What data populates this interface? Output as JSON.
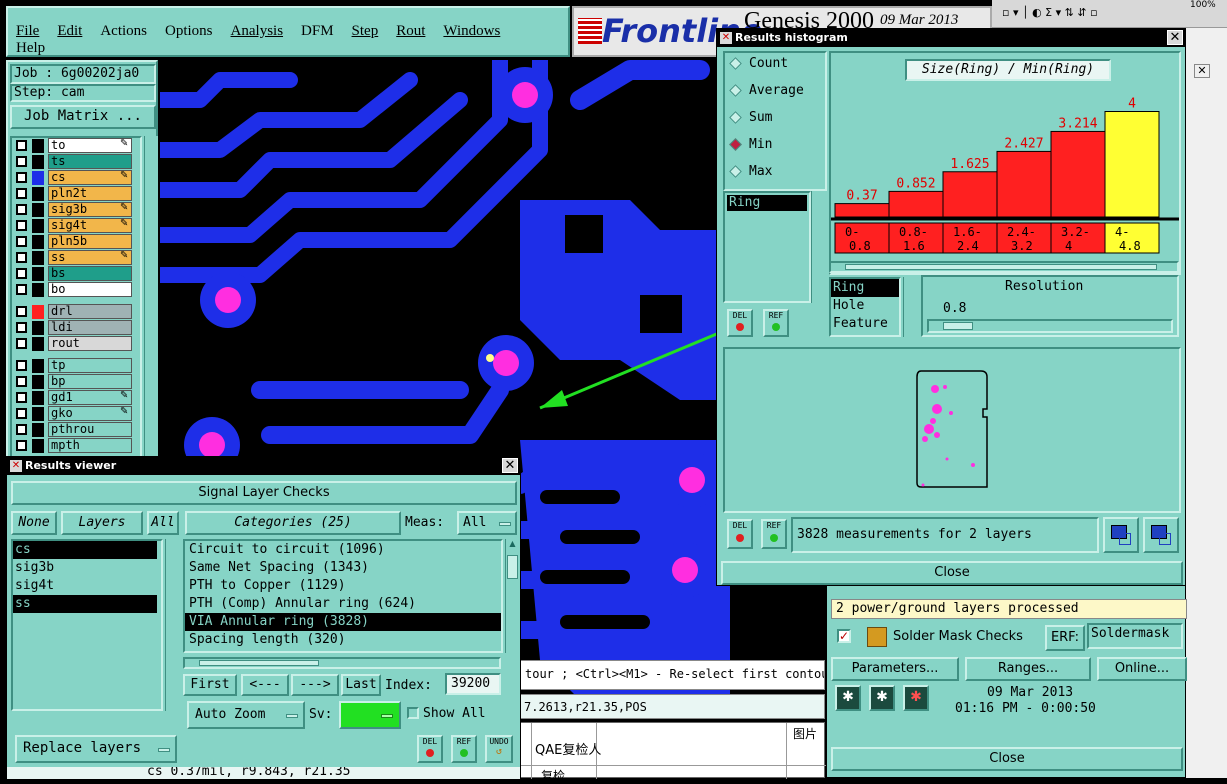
{
  "menu": [
    "File",
    "Edit",
    "Actions",
    "Options",
    "Analysis",
    "DFM",
    "Step",
    "Rout",
    "Windows",
    "Help"
  ],
  "brand": {
    "logo": "Frontline",
    "product": "Genesis 2000",
    "date": "09 Mar 2013"
  },
  "job": {
    "job_line": "Job : 6g00202ja0",
    "step_line": "Step: cam",
    "matrix_button": "Job Matrix ..."
  },
  "layers": [
    {
      "name": "to",
      "color": "#ffffff",
      "edit": true
    },
    {
      "name": "ts",
      "color": "#1f9e8a",
      "edit": false
    },
    {
      "name": "cs",
      "color": "#f2b64a",
      "edit": true
    },
    {
      "name": "pln2t",
      "color": "#f2b64a",
      "edit": false
    },
    {
      "name": "sig3b",
      "color": "#f2b64a",
      "edit": true
    },
    {
      "name": "sig4t",
      "color": "#f2b64a",
      "edit": true
    },
    {
      "name": "pln5b",
      "color": "#f2b64a",
      "edit": false
    },
    {
      "name": "ss",
      "color": "#f2b64a",
      "edit": true
    },
    {
      "name": "bs",
      "color": "#1f9e8a",
      "edit": false
    },
    {
      "name": "bo",
      "color": "#ffffff",
      "edit": false
    },
    {
      "name": "drl",
      "color": "#9fb2b4",
      "edit": false
    },
    {
      "name": "ldi",
      "color": "#9fb2b4",
      "edit": false
    },
    {
      "name": "rout",
      "color": "#d8d8d8",
      "edit": false
    },
    {
      "name": "tp",
      "color": "#86d4c6",
      "edit": false
    },
    {
      "name": "bp",
      "color": "#86d4c6",
      "edit": false
    },
    {
      "name": "gd1",
      "color": "#86d4c6",
      "edit": true
    },
    {
      "name": "gko",
      "color": "#86d4c6",
      "edit": true
    },
    {
      "name": "pthrou",
      "color": "#86d4c6",
      "edit": false
    },
    {
      "name": "mpth",
      "color": "#86d4c6",
      "edit": false
    }
  ],
  "status_bar": {
    "hint": "tour ; <Ctrl><M1> - Re-select first contour",
    "coords": "7.2613,r21.35,POS"
  },
  "results_viewer": {
    "title": "Results viewer",
    "header": "Signal Layer Checks",
    "none_label": "None",
    "layers_label": "Layers",
    "all_label": "All",
    "categories_label": "Categories (25)",
    "meas_label": "Meas:",
    "meas_value": "All",
    "layer_list": [
      "cs",
      "sig3b",
      "sig4t",
      "ss"
    ],
    "categories": [
      "Circuit to circuit (1096)",
      "Same Net Spacing (1343)",
      "PTH to Copper (1129)",
      "PTH (Comp) Annular ring (624)",
      "VIA Annular ring (3828)",
      "Spacing length (320)"
    ],
    "first": "First",
    "prev": "<---",
    "next": "--->",
    "last": "Last",
    "index_label": "Index:",
    "index_value": "39200",
    "auto_zoom": "Auto Zoom",
    "sv_label": "Sv:",
    "show_all": "Show All",
    "replace_layers": "Replace layers",
    "del": "DEL",
    "ref": "REF",
    "undo": "UNDO",
    "footer": "cs 0.37mil, r9.843, r21.35"
  },
  "histogram": {
    "title": "Results histogram",
    "modes": [
      "Count",
      "Average",
      "Sum",
      "Min",
      "Max"
    ],
    "selected_mode": "Min",
    "attr_list_item": "Ring",
    "chart_title": "Size(Ring) / Min(Ring)",
    "resolution_label": "Resolution",
    "resolution_value": "0.8",
    "type_list": [
      "Ring",
      "Hole",
      "Feature"
    ],
    "measurements": "3828 measurements for 2 layers",
    "close": "Close",
    "del": "DEL",
    "ref": "REF"
  },
  "chart_data": {
    "type": "bar",
    "title": "Size(Ring) / Min(Ring)",
    "categories": [
      "0-0.8",
      "0.8-1.6",
      "1.6-2.4",
      "2.4-3.2",
      "3.2-4",
      "4-4.8"
    ],
    "category_labels_top": [
      "0-",
      "0.8-",
      "1.6-",
      "2.4-",
      "3.2-",
      "4-"
    ],
    "category_labels_bottom": [
      "0.8",
      "1.6",
      "2.4",
      "3.2",
      "4",
      "4.8"
    ],
    "values": [
      0.37,
      0.852,
      1.625,
      2.427,
      3.214,
      4
    ],
    "value_labels": [
      "0.37",
      "0.852",
      "1.625",
      "2.427",
      "3.214",
      "4"
    ],
    "ylim": [
      0,
      4.8
    ],
    "colors": [
      "#ff2020",
      "#ff2020",
      "#ff2020",
      "#ff2020",
      "#ff2020",
      "#ffff33"
    ]
  },
  "right_panel": {
    "processed": "2 power/ground layers processed",
    "solder_mask": "Solder Mask Checks",
    "erf_label": "ERF:",
    "erf_value": "Soldermask",
    "parameters": "Parameters...",
    "ranges": "Ranges...",
    "online": "Online...",
    "date": "09 Mar 2013",
    "time": "01:16 PM - 0:00:50",
    "close": "Close"
  },
  "bottom_text": {
    "cell1": "QAE复检人",
    "cell2": "图片",
    "cell3": "复检"
  },
  "colors": {
    "panel": "#86d4c6",
    "trace": "#1e2ee8",
    "pad": "#ff2ee0",
    "arrow": "#22e022"
  }
}
